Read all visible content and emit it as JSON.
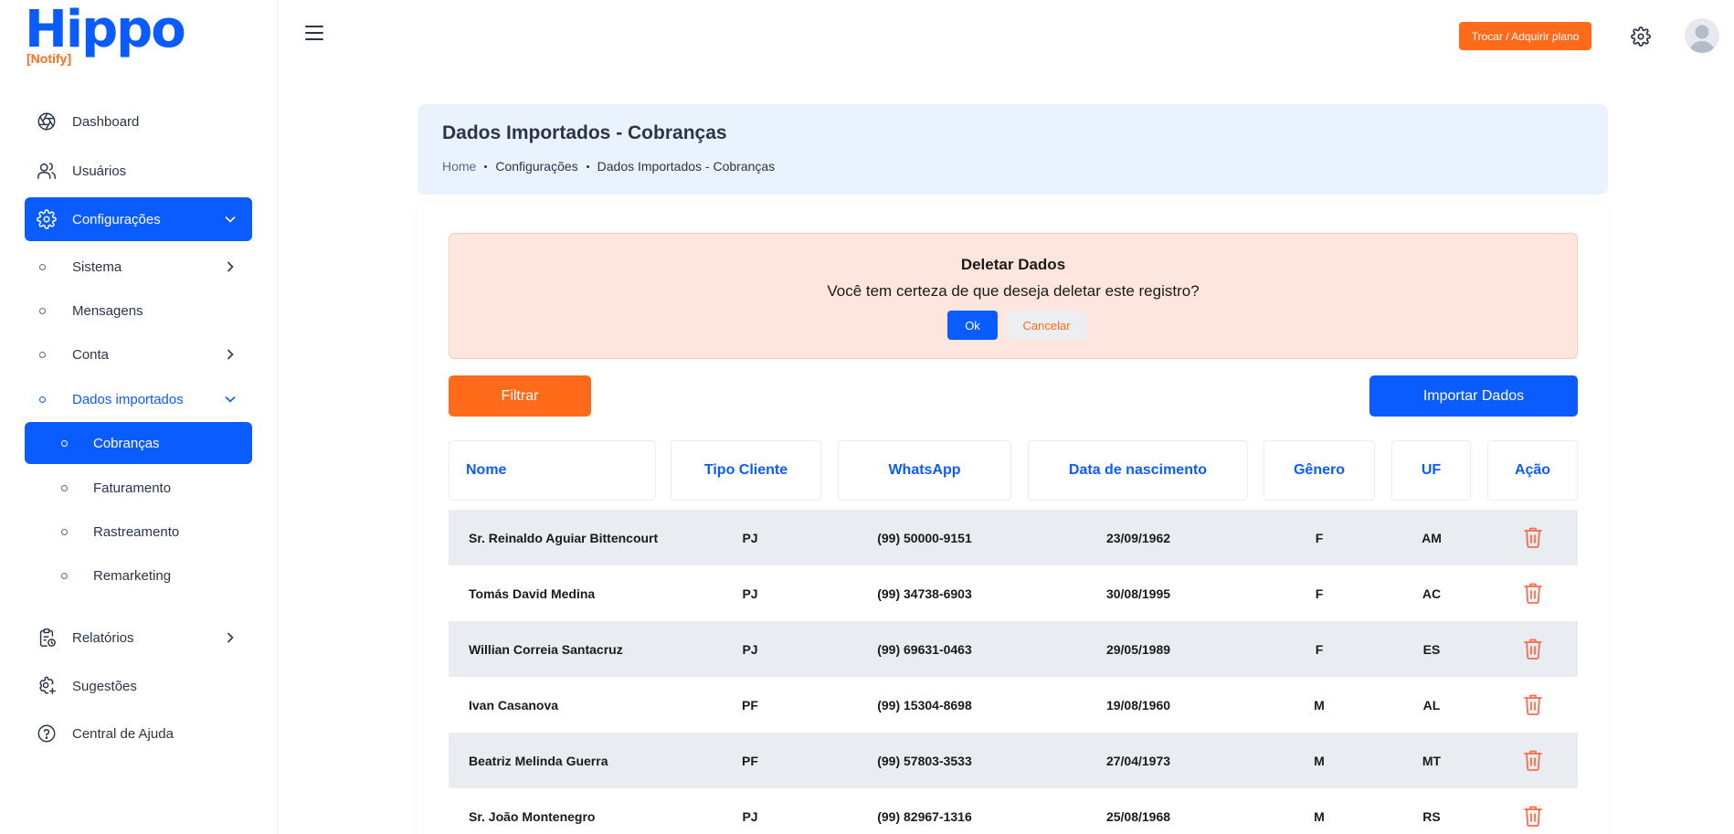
{
  "brand": {
    "logo_main": "Hippo",
    "logo_sub": "[Notify]"
  },
  "sidebar": {
    "items": [
      {
        "label": "Dashboard",
        "icon": "aperture-icon"
      },
      {
        "label": "Usuários",
        "icon": "users-icon"
      },
      {
        "label": "Configurações",
        "icon": "gear-icon"
      }
    ],
    "config_sub": [
      {
        "label": "Sistema"
      },
      {
        "label": "Mensagens"
      },
      {
        "label": "Conta"
      },
      {
        "label": "Dados importados"
      }
    ],
    "imported_sub": [
      {
        "label": "Cobranças"
      },
      {
        "label": "Faturamento"
      },
      {
        "label": "Rastreamento"
      },
      {
        "label": "Remarketing"
      }
    ],
    "bottom": [
      {
        "label": "Relatórios",
        "icon": "clipboard-clock-icon"
      },
      {
        "label": "Sugestões",
        "icon": "gear-plus-icon"
      },
      {
        "label": "Central de Ajuda",
        "icon": "help-circle-icon"
      }
    ]
  },
  "header": {
    "plan_button": "Trocar / Adquirir plano"
  },
  "page": {
    "title": "Dados Importados - Cobranças",
    "breadcrumb": [
      "Home",
      "Configurações",
      "Dados Importados - Cobranças"
    ]
  },
  "alert": {
    "title": "Deletar Dados",
    "message": "Você tem certeza de que deseja deletar este registro?",
    "ok": "Ok",
    "cancel": "Cancelar"
  },
  "toolbar": {
    "filter": "Filtrar",
    "import": "Importar Dados"
  },
  "table": {
    "headers": [
      "Nome",
      "Tipo Cliente",
      "WhatsApp",
      "Data de nascimento",
      "Gênero",
      "UF",
      "Ação"
    ],
    "rows": [
      [
        "Sr. Reinaldo Aguiar Bittencourt",
        "PJ",
        "(99) 50000-9151",
        "23/09/1962",
        "F",
        "AM"
      ],
      [
        "Tomás David Medina",
        "PJ",
        "(99) 34738-6903",
        "30/08/1995",
        "F",
        "AC"
      ],
      [
        "Willian Correia Santacruz",
        "PJ",
        "(99) 69631-0463",
        "29/05/1989",
        "F",
        "ES"
      ],
      [
        "Ivan Casanova",
        "PF",
        "(99) 15304-8698",
        "19/08/1960",
        "M",
        "AL"
      ],
      [
        "Beatriz Melinda Guerra",
        "PF",
        "(99) 57803-3533",
        "27/04/1973",
        "M",
        "MT"
      ],
      [
        "Sr. João Montenegro",
        "PJ",
        "(99) 82967-1316",
        "25/08/1968",
        "M",
        "RS"
      ]
    ]
  },
  "colors": {
    "primary": "#0b5cff",
    "accent": "#ff6b1a",
    "alert_bg": "#fde6dd",
    "row_shade": "#e9edf1"
  }
}
